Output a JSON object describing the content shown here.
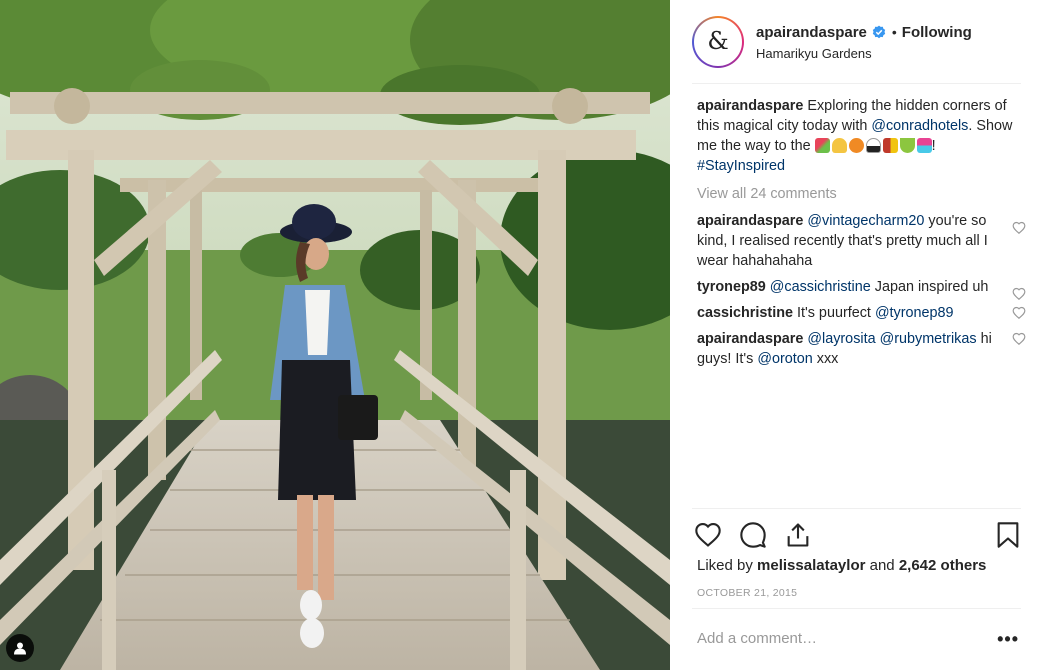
{
  "photo": {
    "alt": ""
  },
  "header": {
    "username": "apairandaspare",
    "verified": true,
    "separator": "•",
    "follow_status": "Following",
    "location": "Hamarikyu Gardens",
    "avatar_mark": "&"
  },
  "caption": {
    "username": "apairandaspare",
    "text_1": "Exploring the hidden corners of this magical city today with",
    "mention_1": "@conradhotels",
    "text_2": ". Show me the way to the",
    "emojis": [
      "ice-pop-emoji",
      "bell-emoji",
      "shrimp-emoji",
      "onigiri-emoji",
      "bento-emoji",
      "matcha-emoji",
      "gem-emoji"
    ],
    "text_3": "!",
    "hashtag": "#StayInspired"
  },
  "view_all_comments": "View all 24 comments",
  "comments": [
    {
      "username": "apairandaspare",
      "mention": "@vintagecharm20",
      "text": " you're so kind, I realised recently that's pretty much all I wear hahahahaha"
    },
    {
      "username": "tyronep89",
      "mention": "@cassichristine",
      "text": " Japan inspired uh"
    },
    {
      "username": "cassichristine",
      "text_before": "It's puurfect ",
      "mention": "@tyronep89"
    },
    {
      "username": "apairandaspare",
      "mention": "@layrosita",
      "mention_2": "@rubymetrikas",
      "text": " hi guys! It's ",
      "mention_3": "@oroton",
      "text_end": " xxx"
    }
  ],
  "likes": {
    "prefix": "Liked by ",
    "user": "melissalataylor",
    "middle": " and ",
    "others": "2,642 others"
  },
  "date": "OCTOBER 21, 2015",
  "add_comment": {
    "placeholder": "Add a comment…"
  },
  "more_label": "•••",
  "icons": {
    "like": "heart-icon",
    "comment": "comment-bubble-icon",
    "share": "share-icon",
    "save": "bookmark-icon",
    "tag": "user-tag-icon"
  },
  "colors": {
    "link": "#003569",
    "verified": "#3897f0",
    "muted": "#999999",
    "text": "#262626"
  }
}
